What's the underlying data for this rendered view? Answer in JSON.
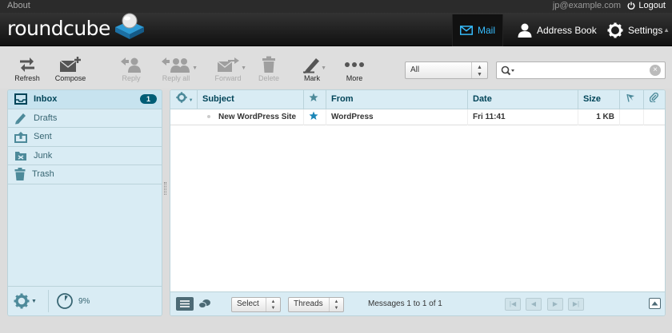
{
  "topline": {
    "about": "About",
    "user": "jp@example.com",
    "logout": "Logout"
  },
  "logo": {
    "text": "roundcube"
  },
  "nav": {
    "mail": "Mail",
    "addressbook": "Address Book",
    "settings": "Settings"
  },
  "toolbar": {
    "refresh": "Refresh",
    "compose": "Compose",
    "reply": "Reply",
    "reply_all": "Reply all",
    "forward": "Forward",
    "delete": "Delete",
    "mark": "Mark",
    "more": "More"
  },
  "filter": {
    "selected": "All"
  },
  "search": {
    "value": "",
    "placeholder": ""
  },
  "folders": [
    {
      "name": "Inbox",
      "icon": "inbox-icon",
      "unread": "1"
    },
    {
      "name": "Drafts",
      "icon": "pencil-icon"
    },
    {
      "name": "Sent",
      "icon": "sent-icon"
    },
    {
      "name": "Junk",
      "icon": "junk-icon"
    },
    {
      "name": "Trash",
      "icon": "trash-icon"
    }
  ],
  "quota": {
    "percent": 9,
    "label": "9%"
  },
  "messagelist": {
    "columns": {
      "subject": "Subject",
      "from": "From",
      "date": "Date",
      "size": "Size"
    },
    "rows": [
      {
        "subject": "New WordPress Site",
        "from": "WordPress",
        "date": "Fri 11:41",
        "size": "1 KB",
        "flagged": true,
        "unread": true
      }
    ]
  },
  "listfooter": {
    "select": "Select",
    "threads": "Threads",
    "count": "Messages 1 to 1 of 1"
  },
  "colors": {
    "accent": "#37beff",
    "panel": "#d9ecf4",
    "badge": "#005d76",
    "header": "#111111"
  }
}
